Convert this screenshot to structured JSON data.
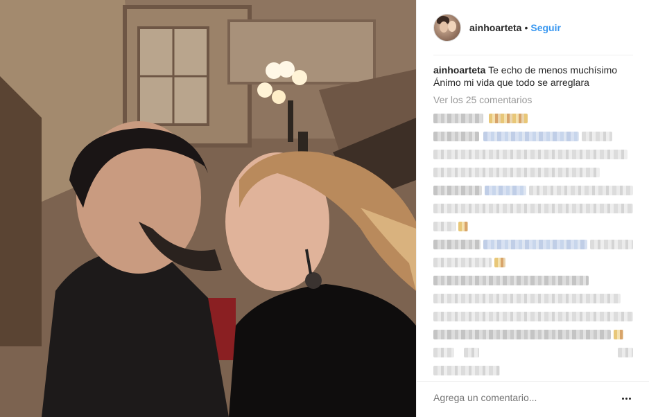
{
  "post": {
    "photo_alt": "Selfie de una pareja besándose en una escalera de un edificio histórico",
    "author": {
      "username": "ainhoarteta",
      "separator": "•",
      "follow_label": "Seguir"
    },
    "caption": {
      "username": "ainhoarteta",
      "text": "Te echo de menos muchísimo Ánimo mi vida que todo se arreglara"
    },
    "view_comments_label": "Ver los 25 comentarios",
    "comments_note": "Comentarios pixelados/ocultos",
    "add_comment_placeholder": "Agrega un comentario...",
    "more_icon": "more-options-icon"
  },
  "colors": {
    "link": "#3897f0",
    "text": "#262626",
    "muted": "#999999",
    "border": "#efefef"
  }
}
